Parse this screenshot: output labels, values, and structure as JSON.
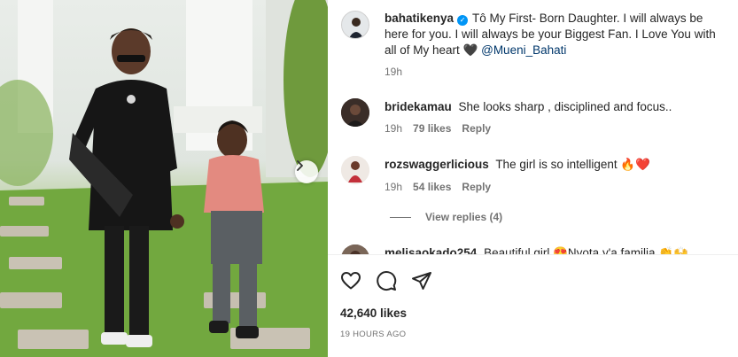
{
  "post": {
    "author": "bahatikenya",
    "caption_text": "Tô My First- Born Daughter. I will always be here for you. I will always be your Biggest Fan. I Love You with all of My heart 🖤",
    "mention": "@Mueni_Bahati",
    "caption_age": "19h",
    "likes": "42,640 likes",
    "timestamp": "19 HOURS AGO"
  },
  "comments": [
    {
      "username": "bridekamau",
      "text": "She looks sharp , disciplined and focus..",
      "age": "19h",
      "likes": "79 likes",
      "reply": "Reply"
    },
    {
      "username": "rozswaggerlicious",
      "text": "The girl is so intelligent 🔥❤️",
      "age": "19h",
      "likes": "54 likes",
      "reply": "Reply",
      "view_replies": "View replies (4)"
    },
    {
      "username": "melisaokado254",
      "text": "Beautiful girl 😍Nyota y'a familia 👏🙌"
    }
  ],
  "icons": {
    "verified": "verified-badge-icon",
    "like": "heart-icon",
    "comment": "comment-bubble-icon",
    "share": "paper-plane-icon",
    "carousel_next": "chevron-right-icon"
  },
  "colors": {
    "verified": "#0095f6",
    "mention": "#00376b",
    "muted": "#737373",
    "text": "#262626"
  }
}
